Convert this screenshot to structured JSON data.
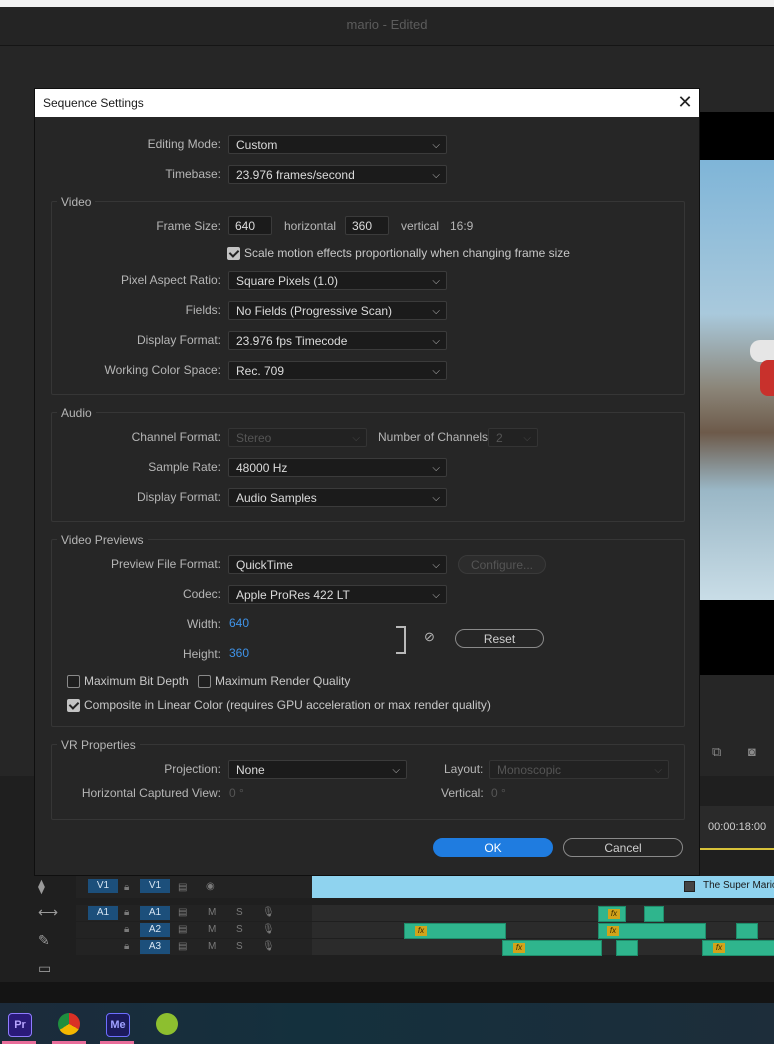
{
  "app": {
    "title": "mario - Edited"
  },
  "timeline": {
    "timecode": "00:00:18:00",
    "clip_name": "The Super Mario E",
    "tracks": {
      "v1": {
        "source": "V1",
        "target": "V1"
      },
      "a1": {
        "source": "A1",
        "target": "A1"
      },
      "a2": {
        "target": "A2"
      },
      "a3": {
        "target": "A3"
      }
    },
    "fx_label": "fx",
    "m_label": "M",
    "s_label": "S"
  },
  "taskbar": {
    "apps": [
      {
        "name": "Premiere Pro",
        "label": "Pr"
      },
      {
        "name": "Chrome",
        "label": ""
      },
      {
        "name": "Media Encoder",
        "label": "Me"
      },
      {
        "name": "Other",
        "label": ""
      }
    ]
  },
  "dialog": {
    "title": "Sequence Settings",
    "editing_mode": {
      "label": "Editing Mode:",
      "value": "Custom"
    },
    "timebase": {
      "label": "Timebase:",
      "value": "23.976  frames/second"
    },
    "video": {
      "title": "Video",
      "frame_size_label": "Frame Size:",
      "width": "640",
      "horizontal_label": "horizontal",
      "height": "360",
      "vertical_label": "vertical",
      "aspect": "16:9",
      "scale_motion": {
        "checked": true,
        "label": "Scale motion effects proportionally when changing frame size"
      },
      "pixel_aspect": {
        "label": "Pixel Aspect Ratio:",
        "value": "Square Pixels (1.0)"
      },
      "fields": {
        "label": "Fields:",
        "value": "No Fields (Progressive Scan)"
      },
      "display_format": {
        "label": "Display Format:",
        "value": "23.976 fps Timecode"
      },
      "color_space": {
        "label": "Working Color Space:",
        "value": "Rec. 709"
      }
    },
    "audio": {
      "title": "Audio",
      "channel_format": {
        "label": "Channel Format:",
        "value": "Stereo"
      },
      "num_channels": {
        "label": "Number of Channels:",
        "value": "2"
      },
      "sample_rate": {
        "label": "Sample Rate:",
        "value": "48000 Hz"
      },
      "display_format": {
        "label": "Display Format:",
        "value": "Audio Samples"
      }
    },
    "previews": {
      "title": "Video Previews",
      "file_format": {
        "label": "Preview File Format:",
        "value": "QuickTime"
      },
      "configure_label": "Configure...",
      "codec": {
        "label": "Codec:",
        "value": "Apple ProRes 422 LT"
      },
      "width": {
        "label": "Width:",
        "value": "640"
      },
      "height": {
        "label": "Height:",
        "value": "360"
      },
      "reset_label": "Reset",
      "max_bit_depth": {
        "checked": false,
        "label": "Maximum Bit Depth"
      },
      "max_render_quality": {
        "checked": false,
        "label": "Maximum Render Quality"
      },
      "composite_linear": {
        "checked": true,
        "label": "Composite in Linear Color (requires GPU acceleration or max render quality)"
      }
    },
    "vr": {
      "title": "VR Properties",
      "projection": {
        "label": "Projection:",
        "value": "None"
      },
      "layout": {
        "label": "Layout:",
        "value": "Monoscopic"
      },
      "h_view": {
        "label": "Horizontal Captured View:",
        "value": "0 °"
      },
      "vertical": {
        "label": "Vertical:",
        "value": "0 °"
      }
    },
    "ok_label": "OK",
    "cancel_label": "Cancel"
  },
  "colors": {
    "accent": "#1f7ce0",
    "link_value": "#3f93e8",
    "clip_audio": "#2fb58d",
    "clip_video": "#8fd3ef",
    "track_tag": "#1c4f7b"
  }
}
